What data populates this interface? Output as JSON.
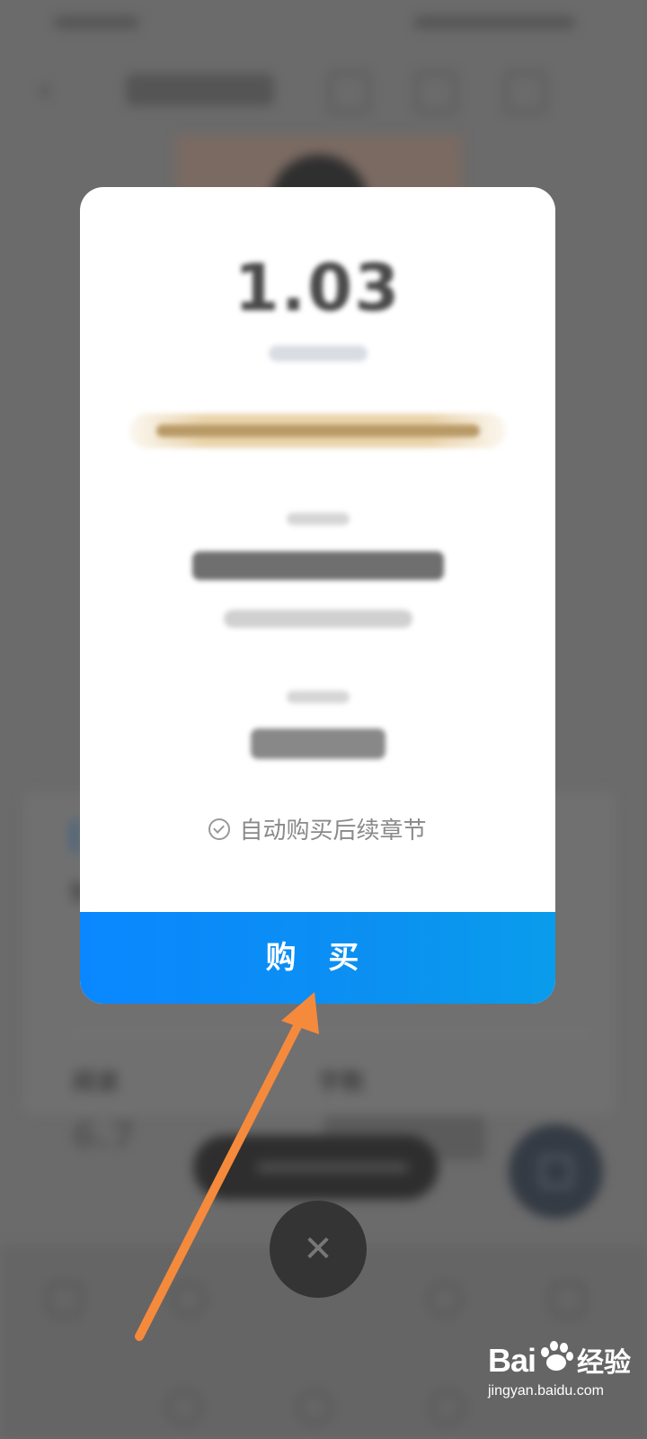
{
  "dialog": {
    "price": "1.03",
    "auto_buy_label": "自动购买后续章节",
    "buy_button_label": "购 买"
  },
  "background": {
    "stats": {
      "read_label": "阅读",
      "words_label": "字数",
      "read_value": "6.7",
      "card_number": "5"
    }
  },
  "watermark": {
    "brand_left": "Bai",
    "brand_right": "经验",
    "url": "jingyan.baidu.com"
  },
  "colors": {
    "buy_button": "#0a8cf5",
    "overlay": "#6b6b6b",
    "annotation_arrow": "#f58a3c"
  }
}
